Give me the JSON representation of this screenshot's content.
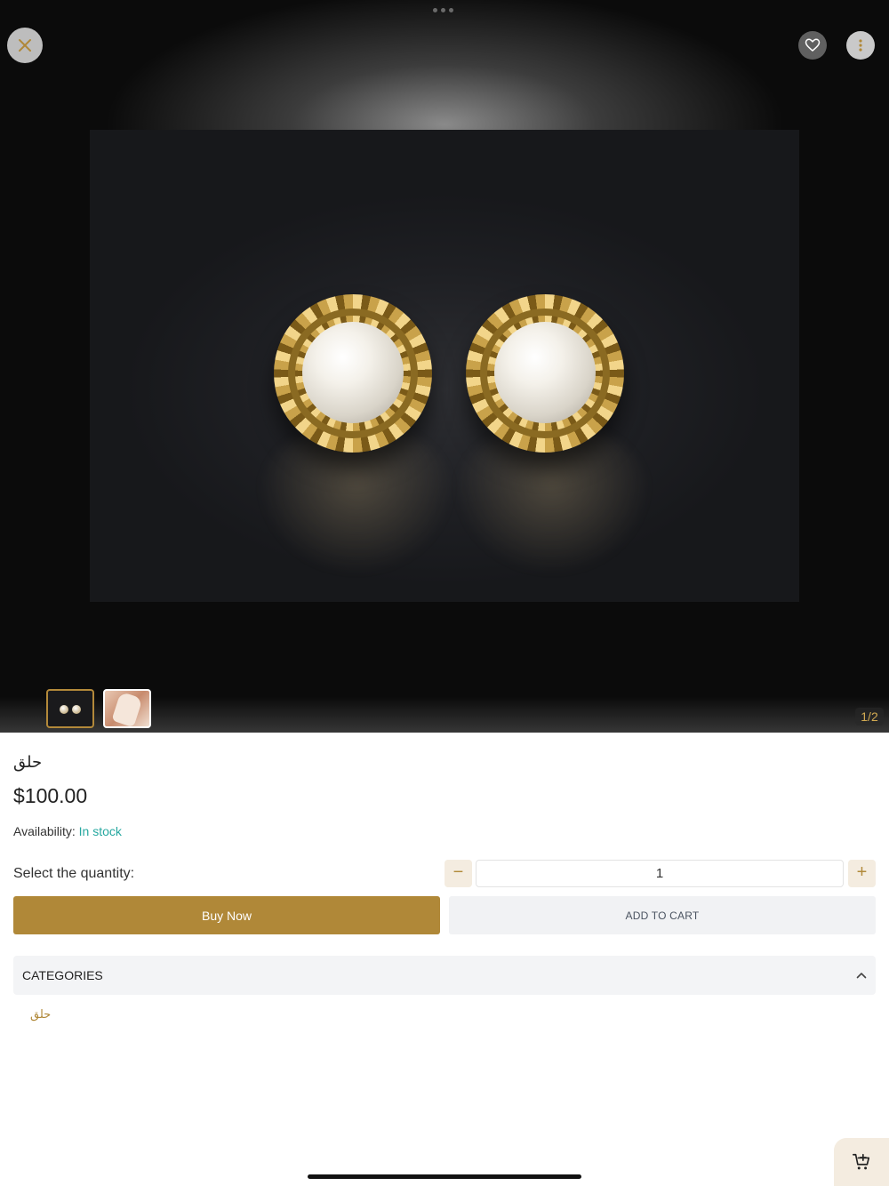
{
  "product": {
    "title": "حلق",
    "price": "$100.00",
    "availability_label": "Availability:",
    "availability_value": "In stock"
  },
  "gallery": {
    "counter": "1/2",
    "thumbnails": [
      "pearl-earrings-thumbnail",
      "hand-earrings-thumbnail"
    ],
    "selected_index": 0
  },
  "quantity": {
    "label": "Select the quantity:",
    "value": "1",
    "minus": "−",
    "plus": "+"
  },
  "actions": {
    "buy_now": "Buy Now",
    "add_to_cart": "ADD TO CART"
  },
  "categories": {
    "header": "CATEGORIES",
    "items": [
      "حلق"
    ],
    "expanded": true
  },
  "icons": {
    "close": "close-icon",
    "favorite": "heart-icon",
    "more": "more-vertical-icon",
    "collapse": "chevron-up-icon",
    "cart": "cart-add-icon"
  },
  "colors": {
    "accent": "#b08838",
    "stock": "#27a8a0",
    "secondary_button_bg": "#f1f2f4",
    "qty_button_bg": "#f4ece0"
  }
}
